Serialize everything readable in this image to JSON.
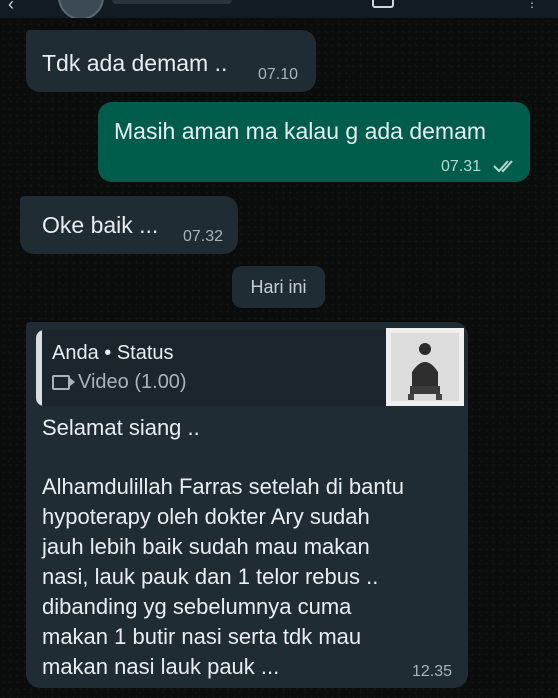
{
  "messages": [
    {
      "text": "Tdk ada demam ..",
      "time": "07.10"
    },
    {
      "text": "Masih aman ma kalau g ada demam",
      "time": "07.31"
    },
    {
      "text": "Oke baik ...",
      "time": "07.32"
    }
  ],
  "date_separator": "Hari ini",
  "reply": {
    "author": "Anda • Status",
    "media_label": "Video (1.00)",
    "greeting": "Selamat siang ..",
    "body": "Alhamdulillah Farras setelah di bantu\nhypoterapy oleh dokter Ary sudah\njauh lebih baik sudah mau makan\nnasi, lauk pauk dan 1 telor rebus ..\ndibanding yg sebelumnya cuma\nmakan 1 butir nasi serta tdk mau\nmakan nasi lauk pauk ...",
    "time": "12.35"
  },
  "colors": {
    "incoming_bubble": "#1f2c34",
    "outgoing_bubble": "#005c4b",
    "read_ticks": "#b8d8cf"
  },
  "icons": [
    "back-arrow-icon",
    "call-icon",
    "menu-icon",
    "read-ticks-icon",
    "video-icon"
  ]
}
